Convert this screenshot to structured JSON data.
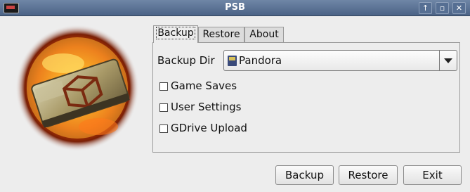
{
  "window": {
    "title": "PSB",
    "controls": [
      "up-arrow-icon",
      "restore-icon",
      "close-icon"
    ]
  },
  "tabs": [
    {
      "label": "Backup",
      "active": true
    },
    {
      "label": "Restore",
      "active": false
    },
    {
      "label": "About",
      "active": false
    }
  ],
  "backup": {
    "dir_label": "Backup Dir",
    "dir_value": "Pandora",
    "options": [
      {
        "label": "Game Saves",
        "checked": false
      },
      {
        "label": "User Settings",
        "checked": false
      },
      {
        "label": "GDrive Upload",
        "checked": false
      }
    ]
  },
  "buttons": {
    "backup": "Backup",
    "restore": "Restore",
    "exit": "Exit"
  },
  "colors": {
    "titlebar": "#566f93",
    "background": "#ededed"
  }
}
